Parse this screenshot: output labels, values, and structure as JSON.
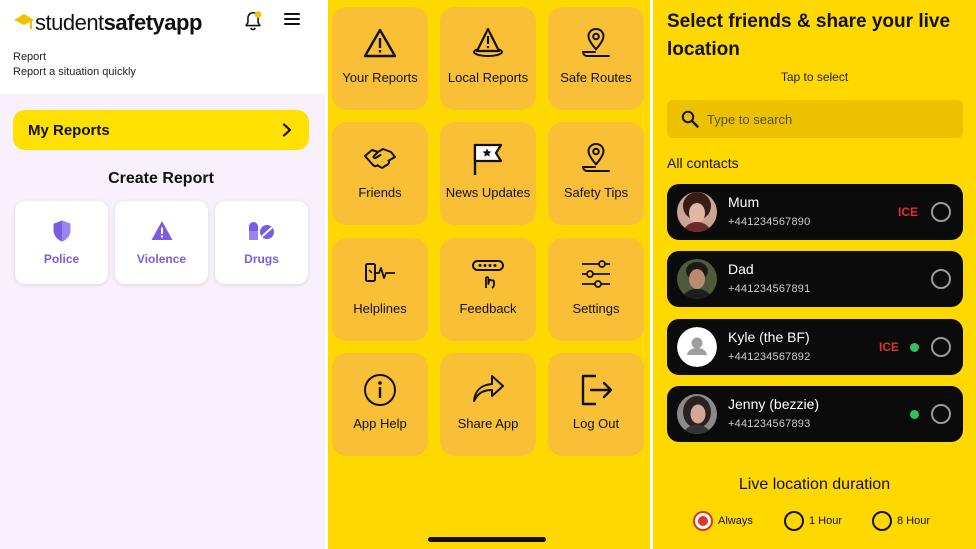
{
  "report_screen": {
    "logo": {
      "part1": "student",
      "part2": "safety",
      "part3": "app"
    },
    "title": "Report",
    "subtitle": "Report a situation quickly",
    "my_reports_label": "My Reports",
    "create_report_title": "Create Report",
    "categories": [
      {
        "label": "Police",
        "icon": "shield-icon"
      },
      {
        "label": "Violence",
        "icon": "warning-icon"
      },
      {
        "label": "Drugs",
        "icon": "pills-icon"
      }
    ],
    "accent_color": "#7c5ce0"
  },
  "menu_screen": {
    "tiles": [
      {
        "label": "Your Reports",
        "icon": "warning-icon"
      },
      {
        "label": "Local Reports",
        "icon": "local-warning-icon"
      },
      {
        "label": "Safe Routes",
        "icon": "location-pin-icon"
      },
      {
        "label": "Friends",
        "icon": "handshake-icon"
      },
      {
        "label": "News Updates",
        "icon": "flag-star-icon"
      },
      {
        "label": "Safety Tips",
        "icon": "location-pin-icon"
      },
      {
        "label": "Helplines",
        "icon": "phone-pulse-icon"
      },
      {
        "label": "Feedback",
        "icon": "rating-feedback-icon"
      },
      {
        "label": "Settings",
        "icon": "sliders-icon"
      },
      {
        "label": "App Help",
        "icon": "info-icon"
      },
      {
        "label": "Share App",
        "icon": "share-arrow-icon"
      },
      {
        "label": "Log Out",
        "icon": "logout-icon"
      }
    ],
    "background_color": "#ffd800",
    "tile_color": "#f8bf37"
  },
  "share_screen": {
    "title": "Select friends & share your live location",
    "hint": "Tap to select",
    "search_placeholder": "Type to search",
    "section_label": "All contacts",
    "contacts": [
      {
        "name": "Mum",
        "phone": "+441234567890",
        "ice": "ICE",
        "online": false
      },
      {
        "name": "Dad",
        "phone": "+441234567891",
        "ice": "",
        "online": false
      },
      {
        "name": "Kyle (the BF)",
        "phone": "+441234567892",
        "ice": "ICE",
        "online": true
      },
      {
        "name": "Jenny (bezzie)",
        "phone": "+441234567893",
        "ice": "",
        "online": true
      }
    ],
    "duration_title": "Live location duration",
    "duration_options": [
      {
        "label": "Always",
        "selected": true
      },
      {
        "label": "1 Hour",
        "selected": false
      },
      {
        "label": "8 Hour",
        "selected": false
      }
    ],
    "ice_color": "#e0312b",
    "online_color": "#33c15a"
  }
}
